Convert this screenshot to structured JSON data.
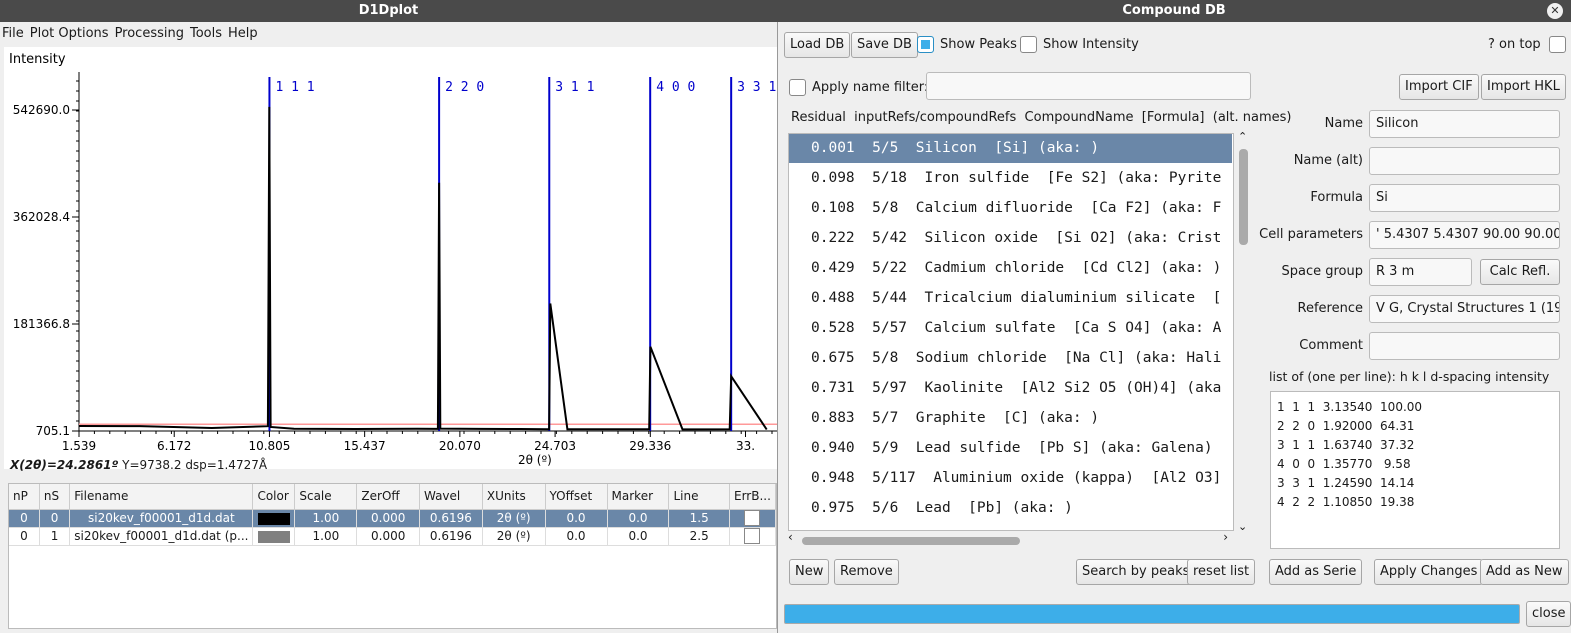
{
  "main_window": {
    "title": "D1Dplot",
    "menu": [
      "File",
      "Plot Options",
      "Processing",
      "Tools",
      "Help"
    ]
  },
  "plot": {
    "y_label": "Intensity",
    "x_label": "2θ (º)",
    "y_ticks": [
      "542690.0",
      "362028.4",
      "181366.8",
      "705.1"
    ],
    "x_ticks": [
      "1.539",
      "6.172",
      "10.805",
      "15.437",
      "20.070",
      "24.703",
      "29.336",
      "33."
    ],
    "status_x": "X(2θ)=24.2861º",
    "status_rest": "Y=9738.2  dsp=1.4727Å",
    "colors": {
      "peak_line": "#0000cc",
      "baseline": "#ff9999",
      "data": "#000000"
    }
  },
  "chart_data": {
    "type": "line",
    "xlabel": "2θ (º)",
    "ylabel": "Intensity",
    "xlim": [
      1.539,
      35.5
    ],
    "ylim": [
      705.1,
      542690.0
    ],
    "series": [
      {
        "name": "si20kev_f00001_d1d.dat",
        "x": [
          1.539,
          4.5,
          8,
          10.73,
          10.8,
          10.86,
          12,
          15,
          18,
          19.0,
          19.06,
          19.12,
          21,
          23,
          24.41,
          24.47,
          25.3,
          28,
          29.28,
          29.34,
          30.9,
          33.2,
          33.27,
          35.0
        ],
        "values": [
          9200,
          8900,
          5800,
          8800,
          548000,
          7500,
          4600,
          4000,
          4500,
          4200,
          420000,
          4700,
          4300,
          4100,
          3800,
          216000,
          3500,
          3700,
          3600,
          143000,
          3400,
          3500,
          93000,
          3300
        ]
      }
    ],
    "peaks": [
      {
        "label": "1 1 1",
        "x": 10.805
      },
      {
        "label": "2 2 0",
        "x": 19.06
      },
      {
        "label": "3 1 1",
        "x": 24.42
      },
      {
        "label": "4 0 0",
        "x": 29.33
      },
      {
        "label": "3 3 1",
        "x": 33.27
      }
    ],
    "baseline": 12000
  },
  "file_table": {
    "headers": [
      "nP",
      "nS",
      "Filename",
      "Color",
      "Scale",
      "ZerOff",
      "Wavel",
      "XUnits",
      "YOffset",
      "Marker",
      "Line",
      "ErrB..."
    ],
    "rows": [
      {
        "nP": "0",
        "nS": "0",
        "filename": "si20kev_f00001_d1d.dat",
        "color": "#000000",
        "scale": "1.00",
        "zeroff": "0.000",
        "wavel": "0.6196",
        "xunits": "2θ (º)",
        "yoffset": "0.0",
        "marker": "0.0",
        "line": "1.5"
      },
      {
        "nP": "0",
        "nS": "1",
        "filename": "si20kev_f00001_d1d.dat (p...",
        "color": "#808080",
        "scale": "1.00",
        "zeroff": "0.000",
        "wavel": "0.6196",
        "xunits": "2θ (º)",
        "yoffset": "0.0",
        "marker": "0.0",
        "line": "2.5"
      }
    ]
  },
  "db": {
    "title": "Compound DB",
    "load_db": "Load DB",
    "save_db": "Save DB",
    "show_peaks": "Show Peaks",
    "show_intensity": "Show Intensity",
    "on_top": "? on top",
    "apply_filter": "Apply name filter:",
    "filter_value": "",
    "list_header": "Residual  inputRefs/compoundRefs  CompoundName  [Formula]  (alt. names)",
    "list": [
      "0.001  5/5  Silicon  [Si] (aka: )",
      "0.098  5/18  Iron sulfide  [Fe S2] (aka: Pyrite",
      "0.108  5/8  Calcium difluoride  [Ca F2] (aka: F",
      "0.222  5/42  Silicon oxide  [Si O2] (aka: Crist",
      "0.429  5/22  Cadmium chloride  [Cd Cl2] (aka: )",
      "0.488  5/44  Tricalcium dialuminium silicate  [",
      "0.528  5/57  Calcium sulfate  [Ca S O4] (aka: A",
      "0.675  5/8  Sodium chloride  [Na Cl] (aka: Hali",
      "0.731  5/97  Kaolinite  [Al2 Si2 O5 (OH)4] (aka",
      "0.883  5/7  Graphite  [C] (aka: )",
      "0.940  5/9  Lead sulfide  [Pb S] (aka: Galena)",
      "0.948  5/117  Aluminium oxide (kappa)  [Al2 O3]",
      "0.975  5/6  Lead  [Pb] (aka: )"
    ],
    "import_cif": "Import CIF",
    "import_hkl": "Import HKL",
    "labels": {
      "name": "Name",
      "name_alt": "Name (alt)",
      "formula": "Formula",
      "cell": "Cell parameters",
      "space_group": "Space group",
      "reference": "Reference",
      "comment": "Comment",
      "refl_list": "list of (one per line): h k l d-spacing intensity"
    },
    "values": {
      "name": "Silicon",
      "name_alt": "",
      "formula": "Si",
      "cell": "'  5.4307  5.4307  90.00  90.00  9",
      "space_group": "R 3 m",
      "reference": "V G, Crystal Structures 1 (1963) '",
      "comment": ""
    },
    "calc_refl": "Calc Refl.",
    "reflections": "1  1  1  3.13540  100.00\n2  2  0  1.92000  64.31\n3  1  1  1.63740  37.32\n4  0  0  1.35770   9.58\n3  3  1  1.24590  14.14\n4  2  2  1.10850  19.38",
    "new": "New",
    "remove": "Remove",
    "search_by_peaks": "Search by peaks",
    "reset_list": "reset list",
    "add_as_serie": "Add as Serie",
    "apply_changes": "Apply Changes",
    "add_as_new": "Add as New",
    "close": "close"
  }
}
